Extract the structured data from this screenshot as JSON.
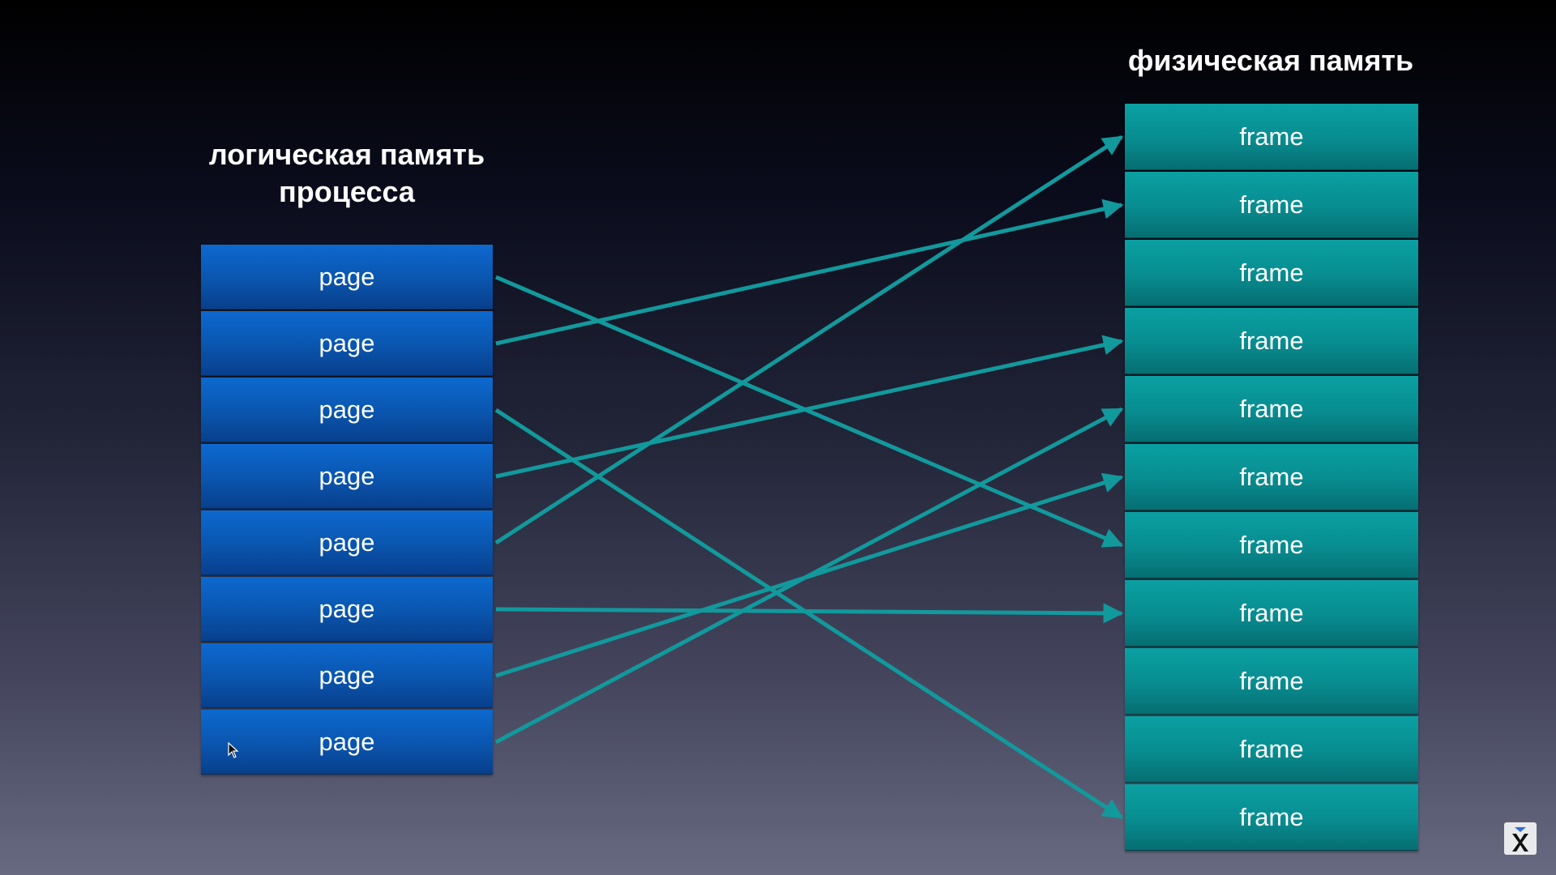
{
  "logical": {
    "title": "логическая память\nпроцесса",
    "pages": [
      "page",
      "page",
      "page",
      "page",
      "page",
      "page",
      "page",
      "page"
    ]
  },
  "physical": {
    "title": "физическая память",
    "frames": [
      "frame",
      "frame",
      "frame",
      "frame",
      "frame",
      "frame",
      "frame",
      "frame",
      "frame",
      "frame",
      "frame"
    ]
  },
  "mapping": [
    {
      "page": 1,
      "frame": 7
    },
    {
      "page": 2,
      "frame": 2
    },
    {
      "page": 3,
      "frame": 11
    },
    {
      "page": 4,
      "frame": 4
    },
    {
      "page": 5,
      "frame": 1
    },
    {
      "page": 6,
      "frame": 8
    },
    {
      "page": 7,
      "frame": 6
    },
    {
      "page": 8,
      "frame": 5
    }
  ],
  "colors": {
    "arrow": "#12999c",
    "page": "#0a55ae",
    "frame": "#088c8f"
  },
  "icons": {
    "cursor": "mouse-pointer-icon",
    "logo": "x-logo-icon"
  }
}
